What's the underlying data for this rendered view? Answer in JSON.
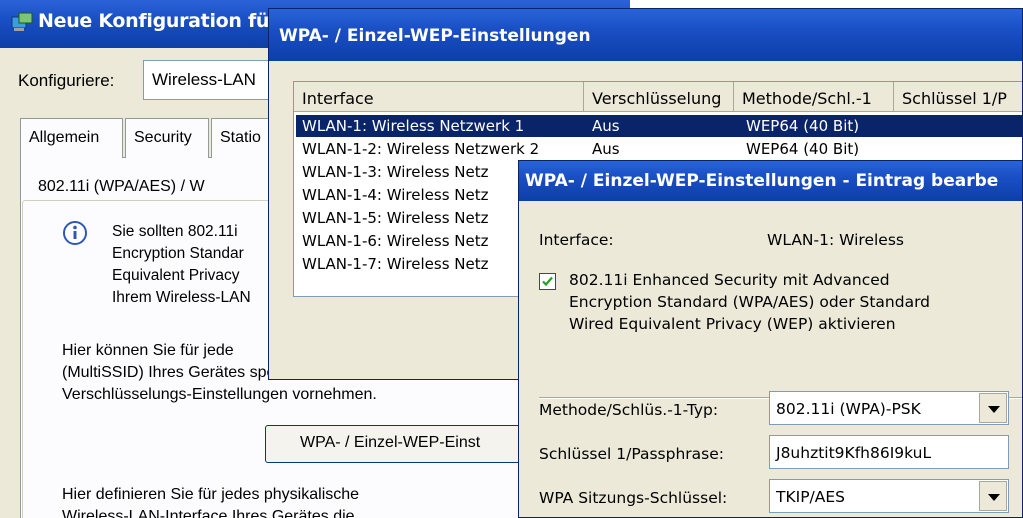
{
  "main_window": {
    "title": "Neue Konfiguration für",
    "configure_label": "Konfiguriere:",
    "configure_value": "Wireless-LAN",
    "tabs": [
      {
        "label": "Allgemein"
      },
      {
        "label": "Security"
      },
      {
        "label": "Statio"
      }
    ],
    "group_title": "802.11i (WPA/AES) / W",
    "info_lines": [
      "Sie sollten 802.11i",
      "Encryption Standar",
      "Equivalent Privacy",
      "Ihrem Wireless-LAN"
    ],
    "text_block_1": [
      "Hier können Sie für jede",
      "(MultiSSID) Ihres Gerätes spezifische",
      "Verschlüsselungs-Einstellungen vornehmen."
    ],
    "wpa_button_label": "WPA- / Einzel-WEP-Einst",
    "text_block_2": [
      "Hier definieren Sie für jedes physikalische",
      "Wireless-LAN-Interface Ihres Gerätes die"
    ]
  },
  "list_window": {
    "title": "WPA- / Einzel-WEP-Einstellungen",
    "columns": [
      "Interface",
      "Verschlüsselung",
      "Methode/Schl.-1",
      "Schlüssel 1/P"
    ],
    "rows": [
      {
        "interface": "WLAN-1: Wireless Netzwerk 1",
        "encryption": "Aus",
        "method": "WEP64 (40 Bit)"
      },
      {
        "interface": "WLAN-1-2: Wireless Netzwerk 2",
        "encryption": "Aus",
        "method": "WEP64 (40 Bit)"
      },
      {
        "interface": "WLAN-1-3: Wireless Netz",
        "encryption": "",
        "method": ""
      },
      {
        "interface": "WLAN-1-4: Wireless Netz",
        "encryption": "",
        "method": ""
      },
      {
        "interface": "WLAN-1-5: Wireless Netz",
        "encryption": "",
        "method": ""
      },
      {
        "interface": "WLAN-1-6: Wireless Netz",
        "encryption": "",
        "method": ""
      },
      {
        "interface": "WLAN-1-7: Wireless Netz",
        "encryption": "",
        "method": ""
      }
    ]
  },
  "edit_window": {
    "title": "WPA- / Einzel-WEP-Einstellungen - Eintrag bearbe",
    "interface_label": "Interface:",
    "interface_value": "WLAN-1: Wireless",
    "checkbox_checked": true,
    "checkbox_lines": [
      "802.11i Enhanced Security mit Advanced",
      "Encryption Standard (WPA/AES) oder Standard",
      "Wired Equivalent Privacy (WEP) aktivieren"
    ],
    "method_label": "Methode/Schlüs.-1-Typ:",
    "method_value": "802.11i (WPA)-PSK",
    "key_label": "Schlüssel 1/Passphrase:",
    "key_value": "J8uhztit9Kfh86I9kuL",
    "session_key_label": "WPA Sitzungs-Schlüssel:",
    "session_key_value": "TKIP/AES"
  },
  "icons": {
    "app": "network-config-icon",
    "info": "info-icon",
    "check": "check-icon",
    "dropdown": "chevron-down-icon"
  },
  "colors": {
    "titlebar": "#1a4fc4",
    "selection": "#0a246a",
    "dialog_bg": "#ece9d8"
  }
}
